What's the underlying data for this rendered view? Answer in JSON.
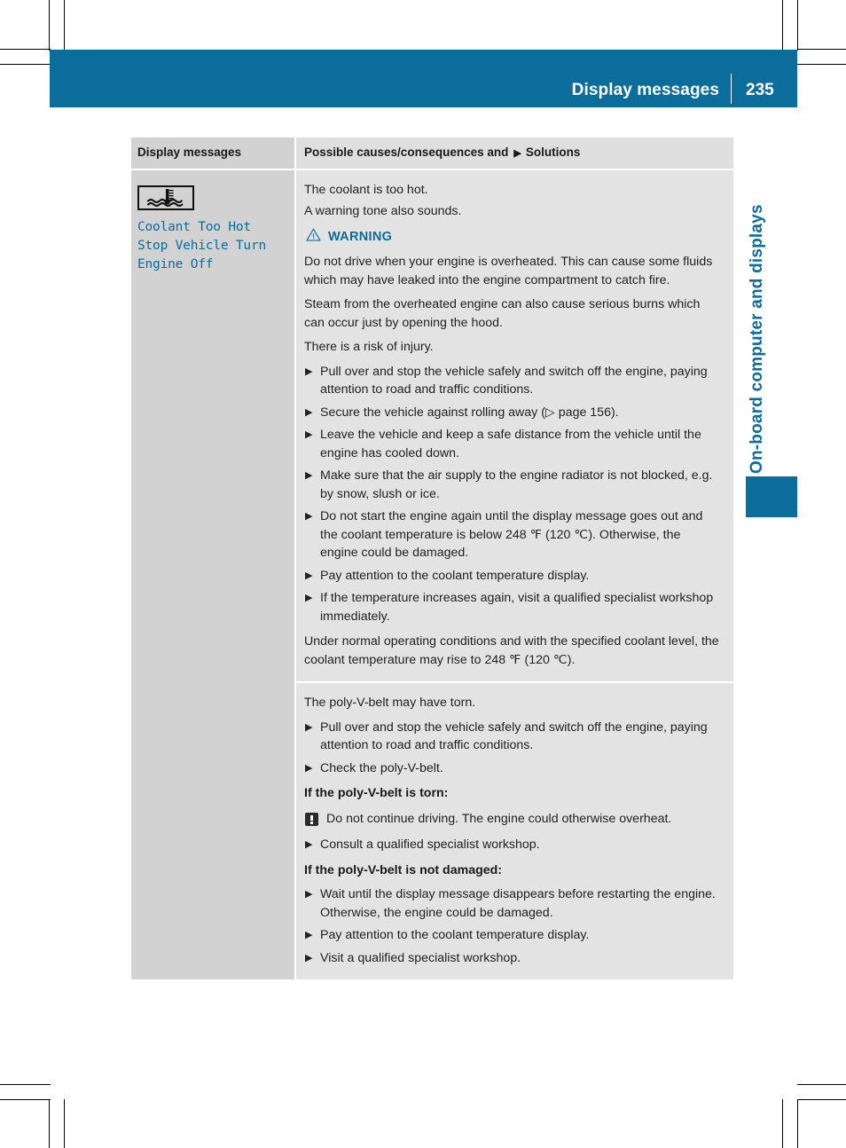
{
  "header": {
    "title": "Display messages",
    "page_number": "235"
  },
  "side_tab": {
    "label": "On-board computer and displays"
  },
  "table": {
    "columns": {
      "left": "Display messages",
      "right_prefix": "Possible causes/consequences and",
      "right_marker": "▶",
      "right_suffix": "Solutions"
    },
    "message": {
      "icon_name": "coolant-temperature-icon",
      "text": "Coolant Too Hot\nStop Vehicle Turn\nEngine Off"
    },
    "rows": [
      {
        "intro": [
          "The coolant is too hot.",
          "A warning tone also sounds."
        ],
        "warning_label": "WARNING",
        "warning_paragraphs": [
          "Do not drive when your engine is overheated. This can cause some fluids which may have leaked into the engine compartment to catch fire.",
          "Steam from the overheated engine can also cause serious burns which can occur just by opening the hood.",
          "There is a risk of injury."
        ],
        "steps": [
          "Pull over and stop the vehicle safely and switch off the engine, paying attention to road and traffic conditions.",
          "Secure the vehicle against rolling away (▷ page 156).",
          "Leave the vehicle and keep a safe distance from the vehicle until the engine has cooled down.",
          "Make sure that the air supply to the engine radiator is not blocked, e.g. by snow, slush or ice.",
          "Do not start the engine again until the display message goes out and the coolant temperature is below 248 ℉ (120 ℃). Otherwise, the engine could be damaged.",
          "Pay attention to the coolant temperature display.",
          "If the temperature increases again, visit a qualified specialist workshop immediately."
        ],
        "closing": "Under normal operating conditions and with the specified coolant level, the coolant temperature may rise to 248 ℉ (120 ℃)."
      },
      {
        "intro": [
          "The poly-V-belt may have torn."
        ],
        "steps_first": [
          "Pull over and stop the vehicle safely and switch off the engine, paying attention to road and traffic conditions.",
          "Check the poly-V-belt."
        ],
        "subhead_torn": "If the poly-V-belt is torn:",
        "notice_text": "Do not continue driving. The engine could otherwise overheat.",
        "steps_torn": [
          "Consult a qualified specialist workshop."
        ],
        "subhead_not_damaged": "If the poly-V-belt is not damaged:",
        "steps_not_damaged": [
          "Wait until the display message disappears before restarting the engine. Otherwise, the engine could be damaged.",
          "Pay attention to the coolant temperature display.",
          "Visit a qualified specialist workshop."
        ]
      }
    ]
  },
  "colors": {
    "brand_blue": "#0a6d9c",
    "header_cell_gray": "#d2d2d2",
    "body_gray": "#e3e3e3"
  }
}
